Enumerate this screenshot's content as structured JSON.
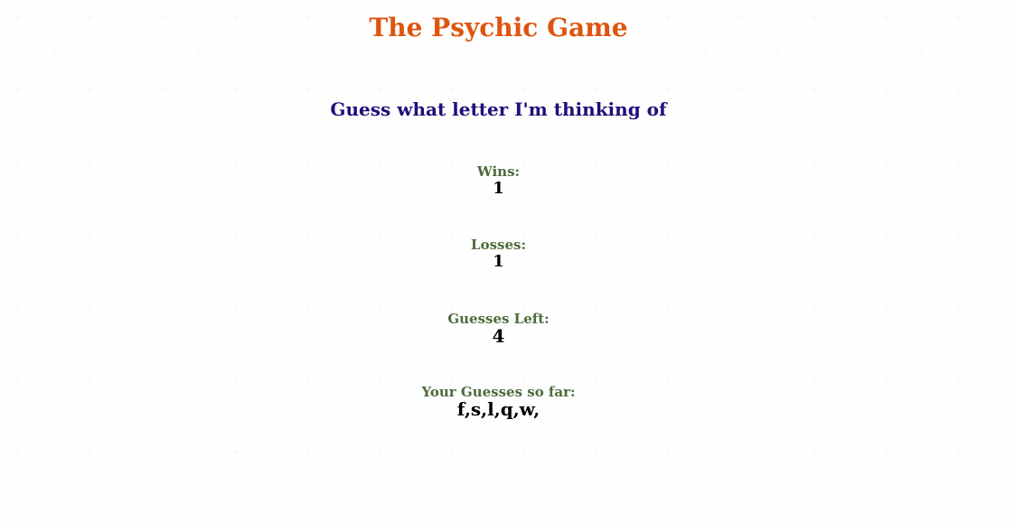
{
  "game": {
    "title": "The Psychic Game",
    "subtitle": "Guess what letter I'm thinking of"
  },
  "stats": {
    "wins_label": "Wins:",
    "wins_value": "1",
    "losses_label": "Losses:",
    "losses_value": "1",
    "guesses_left_label": "Guesses Left:",
    "guesses_left_value": "4",
    "guesses_so_far_label": "Your Guesses so far:",
    "guesses_so_far_value": "f,s,l,q,w,"
  },
  "colors": {
    "title": "#de5410",
    "subtitle": "#1f0f7a",
    "stat_label": "#4d6b3b",
    "stat_value": "#000000"
  }
}
